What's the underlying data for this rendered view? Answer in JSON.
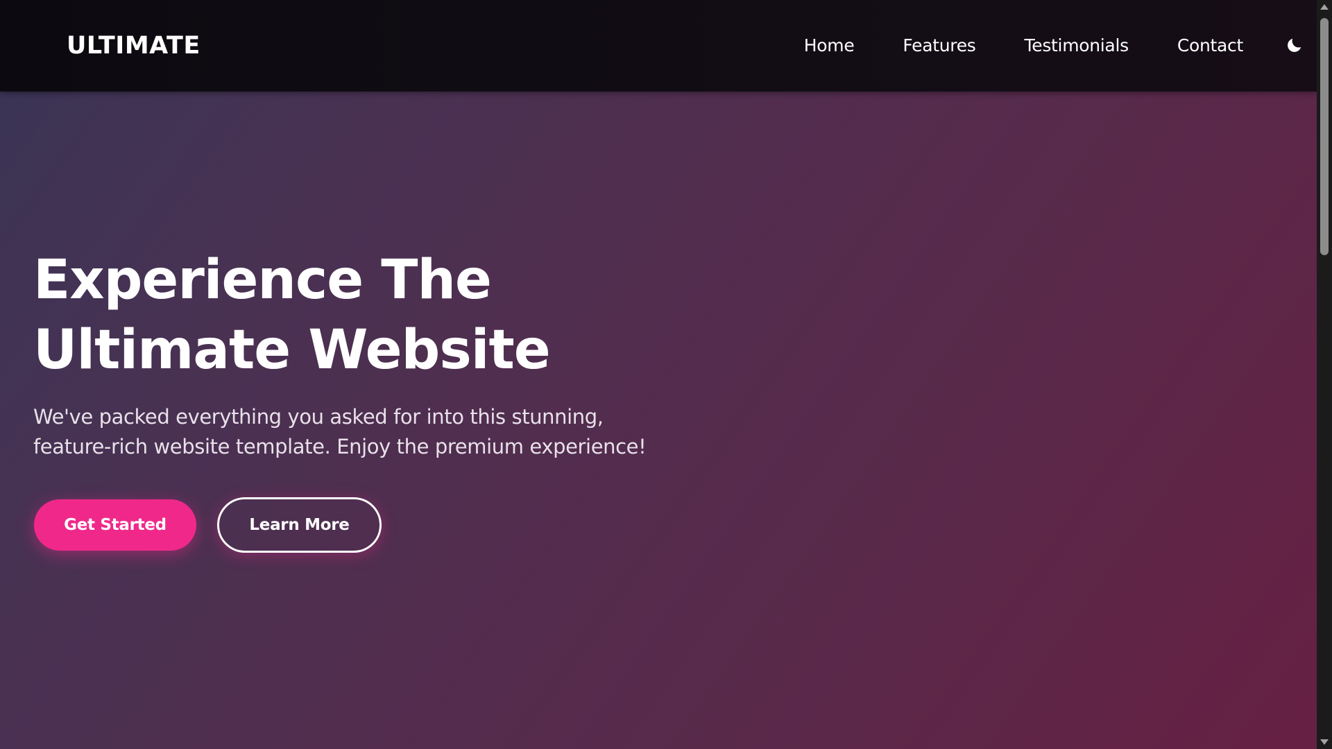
{
  "navbar": {
    "logo": "ULTIMATE",
    "links": [
      {
        "label": "Home"
      },
      {
        "label": "Features"
      },
      {
        "label": "Testimonials"
      },
      {
        "label": "Contact"
      }
    ],
    "theme_toggle_icon": "moon-icon"
  },
  "hero": {
    "title_line1": "Experience The",
    "title_line2": "Ultimate Website",
    "subtitle_line1": "We've packed everything you asked for into this stunning,",
    "subtitle_line2": "feature-rich website template. Enjoy the premium experience!",
    "primary_button": "Get Started",
    "secondary_button": "Learn More"
  },
  "colors": {
    "accent": "#f0288a",
    "navbar_bg": "#0c0a10",
    "hero_gradient_start": "#3b3455",
    "hero_gradient_end": "#662043"
  }
}
